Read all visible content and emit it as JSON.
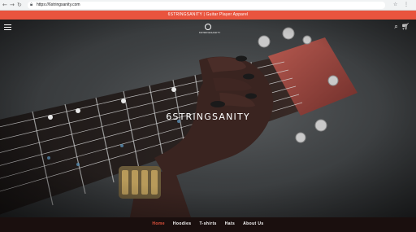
{
  "browser": {
    "url": "https://6stringsanity.com",
    "back_icon": "back-arrow-icon",
    "forward_icon": "forward-arrow-icon",
    "reload_icon": "reload-icon",
    "lock_icon": "lock-icon"
  },
  "announcement": {
    "text": "6STRINGSANITY | Guitar Player Apparel",
    "color": "#e9543e"
  },
  "header": {
    "menu_icon": "hamburger-menu-icon",
    "logo_text": "6STRINGSANITY",
    "search_icon": "search-icon",
    "cart_icon": "cart-icon"
  },
  "hero": {
    "title": "6STRINGSANITY"
  },
  "nav": {
    "items": [
      {
        "label": "Home",
        "active": true
      },
      {
        "label": "Hoodies",
        "active": false
      },
      {
        "label": "T-shirts",
        "active": false
      },
      {
        "label": "Hats",
        "active": false
      },
      {
        "label": "About Us",
        "active": false
      }
    ],
    "accent": "#e9543e"
  }
}
